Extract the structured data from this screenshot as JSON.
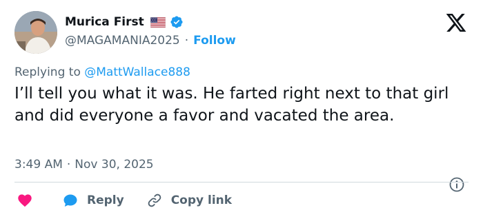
{
  "author": {
    "display_name": "Murica First",
    "handle": "@MAGAMANIA2025",
    "separator": "·",
    "follow_label": "Follow",
    "flag_icon": "us-flag-icon",
    "verified_icon": "verified-badge-icon",
    "verified_color": "#1d9bf0"
  },
  "reply_context": {
    "prefix": "Replying to",
    "mention": "@MattWallace888"
  },
  "tweet": {
    "text": "I’ll tell you what it was. He farted right next to that girl and did everyone a favor and vacated the area.",
    "time": "3:49 AM",
    "separator": "·",
    "date": "Nov 30, 2025"
  },
  "actions": {
    "like_icon": "heart-icon",
    "like_color": "#f91880",
    "reply_label": "Reply",
    "reply_icon": "speech-bubble-icon",
    "reply_color": "#1d9bf0",
    "copy_label": "Copy link",
    "copy_icon": "link-icon"
  },
  "colors": {
    "text": "#0f1419",
    "muted": "#536471",
    "accent": "#1d9bf0",
    "divider": "#cfd9de"
  }
}
